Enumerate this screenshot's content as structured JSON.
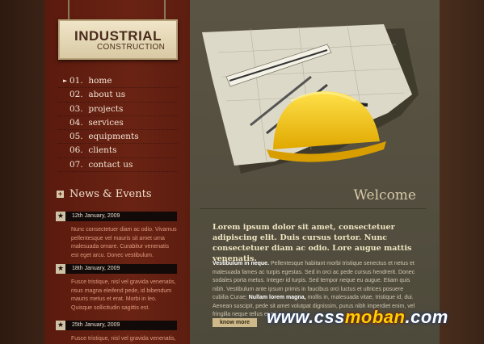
{
  "logo": {
    "line1": "INDUSTRIAL",
    "line2": "CONSTRUCTION"
  },
  "nav": [
    {
      "num": "01.",
      "label": "home",
      "active": true
    },
    {
      "num": "02.",
      "label": "about us"
    },
    {
      "num": "03.",
      "label": "projects"
    },
    {
      "num": "04.",
      "label": "services"
    },
    {
      "num": "05.",
      "label": "equipments"
    },
    {
      "num": "06.",
      "label": "clients"
    },
    {
      "num": "07.",
      "label": "contact us"
    }
  ],
  "news": {
    "heading": "News & Events",
    "items": [
      {
        "date": "12th January, 2009",
        "text": "Nunc consectetuer diam ac odio. Vivamus pellentesque vel mauris sit amet urna malesuada ornare. Curabitur venenatis est eget arcu. Donec vestibulum."
      },
      {
        "date": "18th January, 2009",
        "text": "Fusce tristique, nisl vel gravida venenatis, risus magna eleifend pede, id bibendum mauris metus et erat. Morbi in leo. Quisque sollicitudin sagittis est."
      },
      {
        "date": "25th January, 2009",
        "text": "Fusce tristique, nisl vel gravida venenatis,"
      }
    ]
  },
  "main": {
    "welcome": "Welcome",
    "intro": "Lorem ipsum dolor sit amet, consectetuer adipiscing elit. Duis cursus tortor. Nunc consectetuer diam ac odio. Lore augue mattis venenatis.",
    "body_lead": "Vestibulum in neque.",
    "body_1": " Pellentesque habitant morbi tristique senectus et netus et malesuada fames ac turpis egestas. Sed in orci ac pede cursus hendrerit. Donec sodales porta metus. Integer id turpis. Sed tempor neque eu augue. Etiam quis nibh. Vestibulum ante ipsum primis in faucibus orci luctus et ultrices posuere cubilia Curae; ",
    "body_bold": "Nullam lorem magna,",
    "body_2": " mollis in, malesuada vitae, tristique id, dui. Aenean suscipit, pede sit amet volutpat dignissim, purus nibh imperdiet enim, vel fringilla neque tellus et mi.",
    "more": "know more"
  },
  "watermark": {
    "part1": "www.css",
    "part2": "moban",
    "part3": ".com"
  }
}
